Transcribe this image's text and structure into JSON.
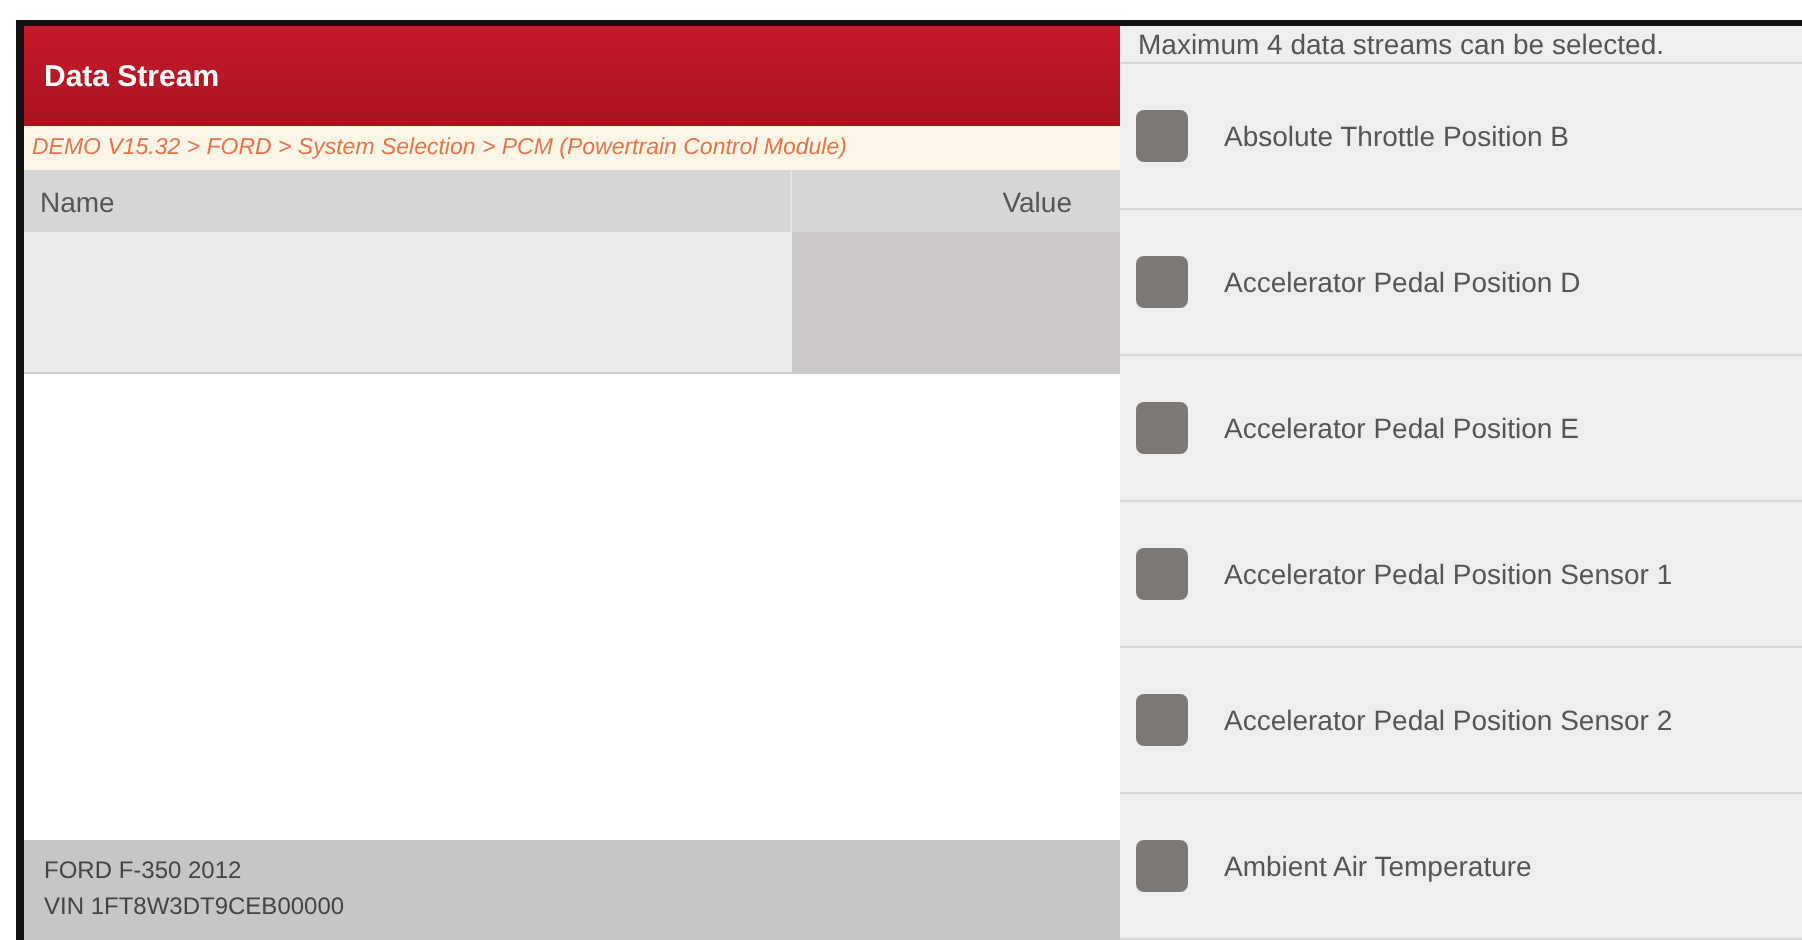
{
  "header": {
    "title": "Data Stream"
  },
  "breadcrumb": "DEMO V15.32 > FORD > System Selection > PCM (Powertrain Control Module)",
  "table": {
    "columns": [
      "Name",
      "Value"
    ]
  },
  "footer": {
    "vehicle": "FORD F-350 2012",
    "vin": "VIN 1FT8W3DT9CEB00000"
  },
  "selection": {
    "message": "Maximum 4 data streams can be selected.",
    "items": [
      {
        "label": "Absolute Throttle Position B",
        "checked": false
      },
      {
        "label": "Accelerator Pedal Position D",
        "checked": false
      },
      {
        "label": "Accelerator Pedal Position E",
        "checked": false
      },
      {
        "label": "Accelerator Pedal Position Sensor 1",
        "checked": false
      },
      {
        "label": "Accelerator Pedal Position Sensor 2",
        "checked": false
      },
      {
        "label": "Ambient Air Temperature",
        "checked": false
      }
    ]
  }
}
